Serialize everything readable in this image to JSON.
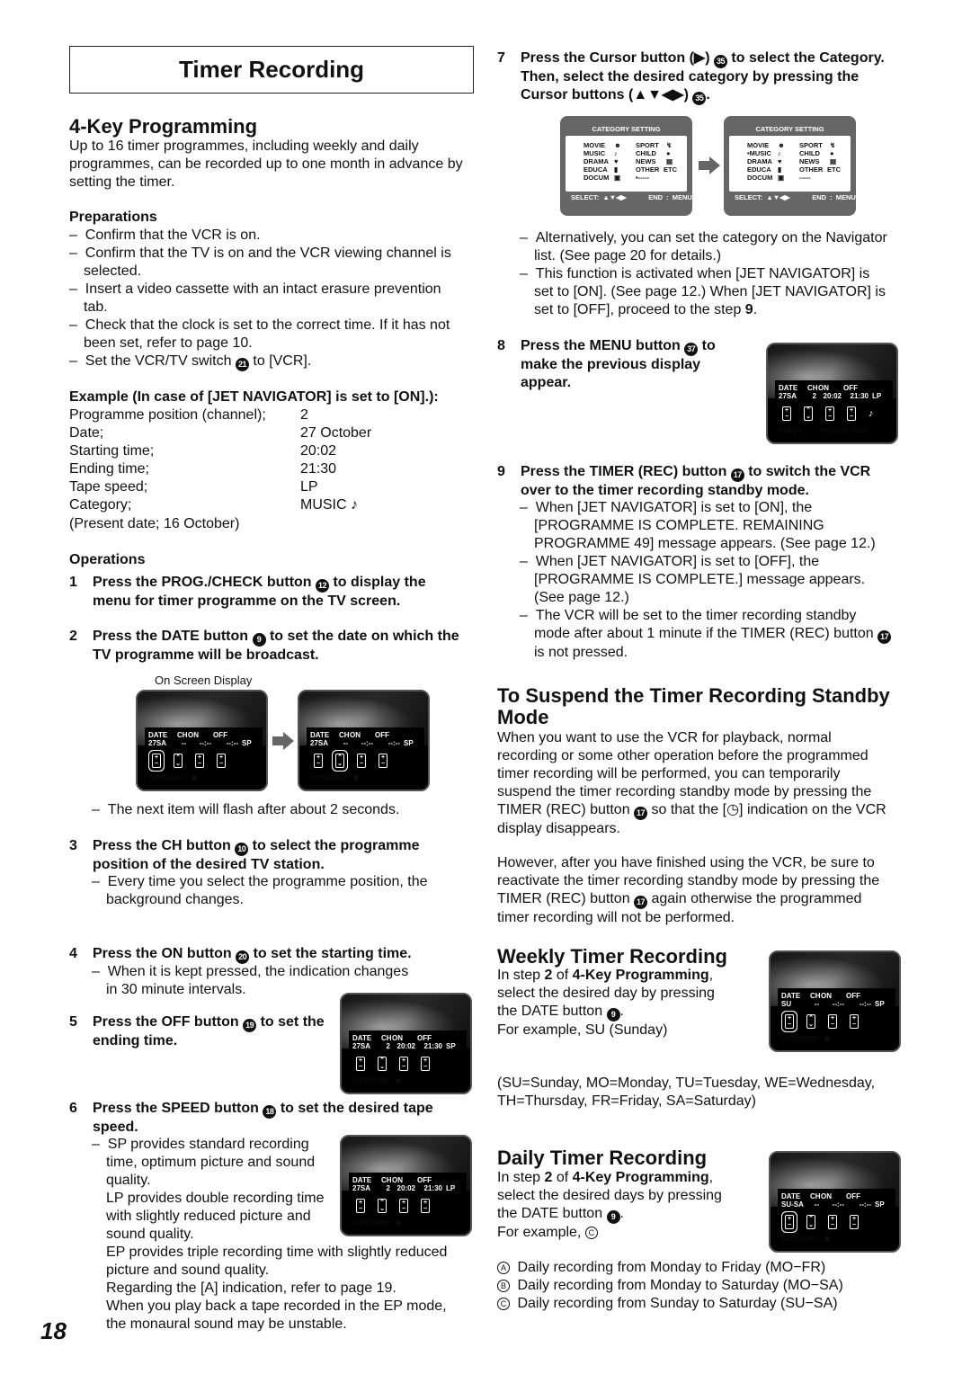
{
  "title": "Timer Recording",
  "page_number": "18",
  "left": {
    "heading": "4-Key Programming",
    "intro": "Up to 16 timer programmes, including weekly and daily\nprogrammes, can be recorded up to one month in advance by\nsetting the timer.",
    "prep_heading": "Preparations",
    "prep": [
      "–\tConfirm that the VCR is on.",
      "–\tConfirm that the TV is on and the VCR viewing channel is\nselected.",
      "–\tInsert a video cassette with an intact erasure prevention\ntab.",
      "–\tCheck that the clock is set to the correct time. If it has not\nbeen set, refer to page 10.",
      "–\tSet the VCR/TV switch [[21]] to [VCR]."
    ],
    "example_heading": "Example (In case of [JET NAVIGATOR] is set to [ON].):",
    "example": [
      [
        "Programme position (channel);",
        "2"
      ],
      [
        "Date;",
        "27 October"
      ],
      [
        "Starting time;",
        "20:02"
      ],
      [
        "Ending time;",
        "21:30"
      ],
      [
        "Tape speed;",
        "LP"
      ],
      [
        "Category;",
        "MUSIC ♪"
      ]
    ],
    "present": "(Present date; 16 October)",
    "ops_heading": "Operations",
    "step1": {
      "n": "1",
      "t": "Press the PROG./CHECK button [[12]] to display the\nmenu for timer programme on the TV screen."
    },
    "step2": {
      "n": "2",
      "t": "Press the DATE button [[9]] to set the date on which the\nTV programme will be broadcast."
    },
    "osd_label": "On Screen Display",
    "step2_note": "–\tThe next item will flash after about 2 seconds.",
    "step3": {
      "n": "3",
      "t": "Press the CH button [[10]] to select the programme\nposition of the desired TV station."
    },
    "step3_note": "–\tEvery time you select the programme position, the\nbackground changes.",
    "step4": {
      "n": "4",
      "t": "Press the ON button [[20]] to set the starting time."
    },
    "step4_note": "–\tWhen it is kept pressed, the indication changes\nin 30 minute intervals.",
    "step5": {
      "n": "5",
      "t": "Press the OFF button [[19]] to set the\nending time."
    },
    "step6": {
      "n": "6",
      "t": "Press the SPEED button [[18]] to set the desired tape\nspeed."
    },
    "step6_notes": "–\tSP provides standard recording\ntime, optimum picture and sound\nquality.\nLP provides double recording time\nwith slightly reduced picture and\nsound quality.\nEP provides triple recording time with slightly reduced\npicture and sound quality.\nRegarding the [A] indication, refer to page 19.\nWhen you play back a tape recorded in the EP mode,\nthe monaural sound may be unstable."
  },
  "right": {
    "step7": {
      "n": "7",
      "t": "Press the Cursor button (▶) [[35]] to select the Category.\nThen, select the desired category by pressing the\nCursor buttons (▲▼◀▶) [[35]]."
    },
    "category": {
      "header": "CATEGORY SETTING",
      "col1": [
        "MOVIE",
        "MUSIC",
        "DRAMA",
        "EDUCA",
        "DOCUM"
      ],
      "col2": [
        "SPORT",
        "CHILD",
        "NEWS",
        "OTHER",
        "-----"
      ],
      "select": "SELECT: ▲▼◀▶",
      "end": "END : MENU"
    },
    "step7_notes": [
      "–\tAlternatively, you can set the category on the Navigator\nlist. (See page 20 for details.)",
      "–\tThis function is activated when [JET NAVIGATOR] is\nset to [ON]. (See page 12.) When [JET NAVIGATOR] is\nset to [OFF], proceed to the step **9**."
    ],
    "step8": {
      "n": "8",
      "t": "Press the MENU button [[37]] to\nmake the previous display\nappear."
    },
    "step9": {
      "n": "9",
      "t": "Press the TIMER (REC) button [[17]] to switch the VCR\nover to the timer recording standby mode."
    },
    "step9_notes": [
      "–\tWhen [JET NAVIGATOR] is set to [ON], the\n[PROGRAMME IS COMPLETE. REMAINING\nPROGRAMME 49] message appears. (See page 12.)",
      "–\tWhen [JET NAVIGATOR] is set to [OFF], the\n[PROGRAMME IS COMPLETE.] message appears.\n(See page 12.)",
      "–\tThe VCR will be set to the timer recording standby\nmode after about 1 minute if the TIMER (REC) button [[17]]\nis not pressed."
    ],
    "suspend_heading": "To Suspend the Timer Recording Standby\nMode",
    "suspend_p1": "When you want to use the VCR for playback, normal\nrecording or some other operation before the programmed\ntimer recording will be performed, you can temporarily\nsuspend the timer recording standby mode by pressing the\nTIMER (REC) button [[17]] so that the [◷] indication on the VCR\ndisplay disappears.",
    "suspend_p2": "However, after you have finished using the VCR, be sure to\nreactivate the timer recording standby mode by pressing the\nTIMER (REC) button [[17]] again otherwise the programmed\ntimer recording will not be performed.",
    "weekly_heading": "Weekly Timer Recording",
    "weekly_p": "In step **2** of **4-Key Programming**,\nselect the desired day by pressing\nthe DATE button [[9]].\nFor example, SU (Sunday)",
    "weekly_days": "(SU=Sunday, MO=Monday, TU=Tuesday, WE=Wednesday,\nTH=Thursday, FR=Friday, SA=Saturday)",
    "daily_heading": "Daily Timer Recording",
    "daily_p": "In step **2** of **4-Key Programming**,\nselect the desired days by pressing\nthe DATE button [[9]].\nFor example, ((C))",
    "daily_opts": [
      "((A)) Daily recording from Monday to Friday (MO−FR)",
      "((B)) Daily recording from Monday to Saturday (MO−SA)",
      "((C)) Daily recording from Sunday to Saturday (SU−SA)"
    ]
  },
  "screens": {
    "s2a": {
      "labels": [
        "DATE",
        "CH",
        "ON",
        "OFF"
      ],
      "vals": [
        "27SA",
        "--",
        "--:--",
        "--:--",
        "SP"
      ],
      "flash": 0,
      "footer": "CATEGORY : ▣"
    },
    "s2b": {
      "labels": [
        "DATE",
        "CH",
        "ON",
        "OFF"
      ],
      "vals": [
        "27SA",
        "--",
        "--:--",
        "--:--",
        "SP"
      ],
      "flash": 1,
      "footer": "CATEGORY : ▣"
    },
    "s5": {
      "labels": [
        "DATE",
        "CH",
        "ON",
        "OFF"
      ],
      "vals": [
        "27SA",
        "2",
        "20:02",
        "21:30",
        "SP"
      ],
      "flash": -1,
      "footer": "CATEGORY : ▣"
    },
    "s6": {
      "labels": [
        "DATE",
        "CH",
        "ON",
        "OFF"
      ],
      "vals": [
        "27SA",
        "2",
        "20:02",
        "21:30",
        "LP"
      ],
      "flash": -1,
      "footer": "CATEGORY : ▣"
    },
    "s8": {
      "labels": [
        "DATE",
        "CH",
        "ON",
        "OFF"
      ],
      "vals": [
        "27SA",
        "2",
        "20:02",
        "21:30",
        "LP"
      ],
      "flash": -1,
      "footer": "CHECK        : PROG./CHECK",
      "note": "♪"
    },
    "sw": {
      "labels": [
        "DATE",
        "CH",
        "ON",
        "OFF"
      ],
      "vals": [
        "SU",
        "--",
        "--:--",
        "--:--",
        "SP"
      ],
      "flash": 0,
      "footer": "CATEGORY : ▣"
    },
    "sd": {
      "labels": [
        "DATE",
        "CH",
        "ON",
        "OFF"
      ],
      "vals": [
        "SU-SA",
        "--",
        "--:--",
        "--:--",
        "SP"
      ],
      "flash": 0,
      "footer": "CATEGORY : ▣"
    }
  }
}
